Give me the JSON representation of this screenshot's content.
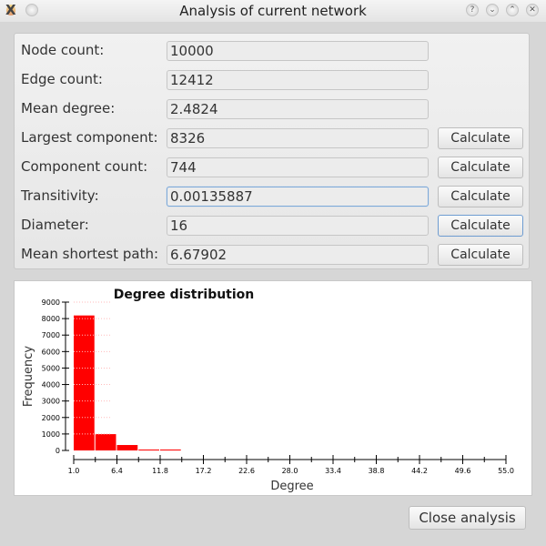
{
  "window": {
    "title": "Analysis of current network",
    "controls": [
      "help",
      "minimize",
      "maximize",
      "close"
    ]
  },
  "form": {
    "rows": [
      {
        "label": "Node count:",
        "value": "10000",
        "has_button": false
      },
      {
        "label": "Edge count:",
        "value": "12412",
        "has_button": false
      },
      {
        "label": "Mean degree:",
        "value": "2.4824",
        "has_button": false
      },
      {
        "label": "Largest component:",
        "value": "8326",
        "has_button": true,
        "button": "Calculate"
      },
      {
        "label": "Component count:",
        "value": "744",
        "has_button": true,
        "button": "Calculate"
      },
      {
        "label": "Transitivity:",
        "value": "0.00135887",
        "has_button": true,
        "button": "Calculate"
      },
      {
        "label": "Diameter:",
        "value": "16",
        "has_button": true,
        "button": "Calculate"
      },
      {
        "label": "Mean shortest path:",
        "value": "6.67902",
        "has_button": true,
        "button": "Calculate"
      }
    ]
  },
  "footer": {
    "close_label": "Close analysis"
  },
  "colors": {
    "bar": "#ff0000",
    "focus": "#7ca8d8"
  },
  "chart_data": {
    "type": "bar",
    "title": "Degree distribution",
    "xlabel": "Degree",
    "ylabel": "Frequency",
    "bins": [
      [
        1.0,
        3.7
      ],
      [
        3.7,
        6.4
      ],
      [
        6.4,
        9.1
      ],
      [
        9.1,
        11.8
      ],
      [
        11.8,
        14.5
      ]
    ],
    "values": [
      8190,
      990,
      330,
      55,
      55
    ],
    "xlim": [
      1.0,
      55.0
    ],
    "ylim": [
      0,
      9000
    ],
    "xticks": [
      "1.0",
      "6.4",
      "11.8",
      "17.2",
      "22.6",
      "28.0",
      "33.4",
      "38.8",
      "44.2",
      "49.6",
      "55.0"
    ],
    "yticks": [
      "0",
      "1000",
      "2000",
      "3000",
      "4000",
      "5000",
      "6000",
      "7000",
      "8000",
      "9000"
    ],
    "grid": true
  }
}
